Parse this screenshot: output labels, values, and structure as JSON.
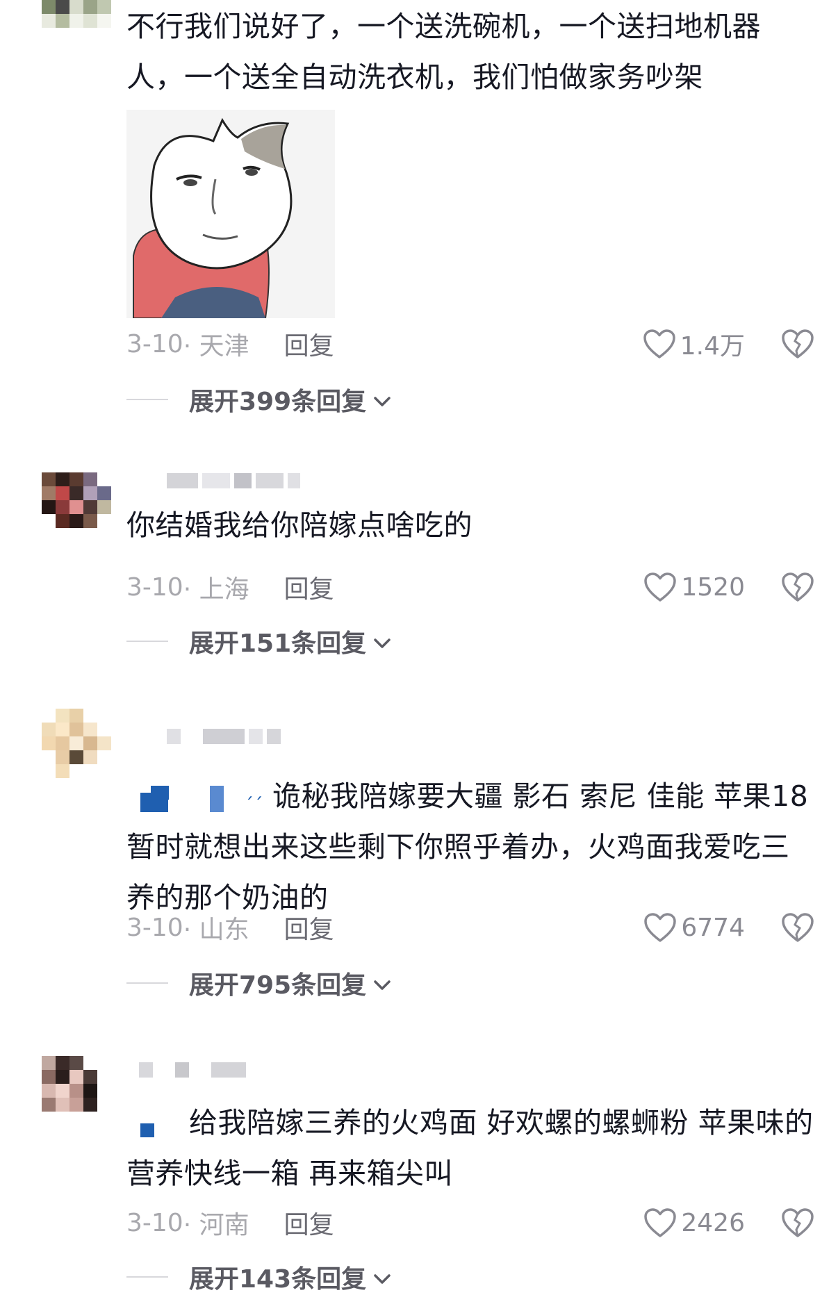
{
  "comments": [
    {
      "text": "不行我们说好了，一个送洗碗机，一个送扫地机器人，一个送全自动洗衣机，我们怕做家务吵架",
      "date": "3-10",
      "location": "· 天津",
      "reply": "回复",
      "likes": "1.4万",
      "expand": "展开399条回复"
    },
    {
      "text": "你结婚我给你陪嫁点啥吃的",
      "date": "3-10",
      "location": "· 上海",
      "reply": "回复",
      "likes": "1520",
      "expand": "展开151条回复"
    },
    {
      "text": "诡秘我陪嫁要大疆 影石 索尼 佳能 苹果18 暂时就想出来这些剩下你照乎着办，火鸡面我爱吃三养的那个奶油的",
      "date": "3-10",
      "location": "· 山东",
      "reply": "回复",
      "likes": "6774",
      "expand": "展开795条回复"
    },
    {
      "text": "给我陪嫁三养的火鸡面 好欢螺的螺蛳粉 苹果味的营养快线一箱 再来箱尖叫",
      "date": "3-10",
      "location": "· 河南",
      "reply": "回复",
      "likes": "2426",
      "expand": "展开143条回复"
    }
  ],
  "icons": {
    "like": "heart-outline-icon",
    "dislike": "broken-heart-icon",
    "expand": "chevron-down-icon"
  },
  "colors": {
    "text": "#161823",
    "meta": "#a8a8ad",
    "reply": "#6b6b73",
    "accent_blue": "#1f5fb0"
  }
}
